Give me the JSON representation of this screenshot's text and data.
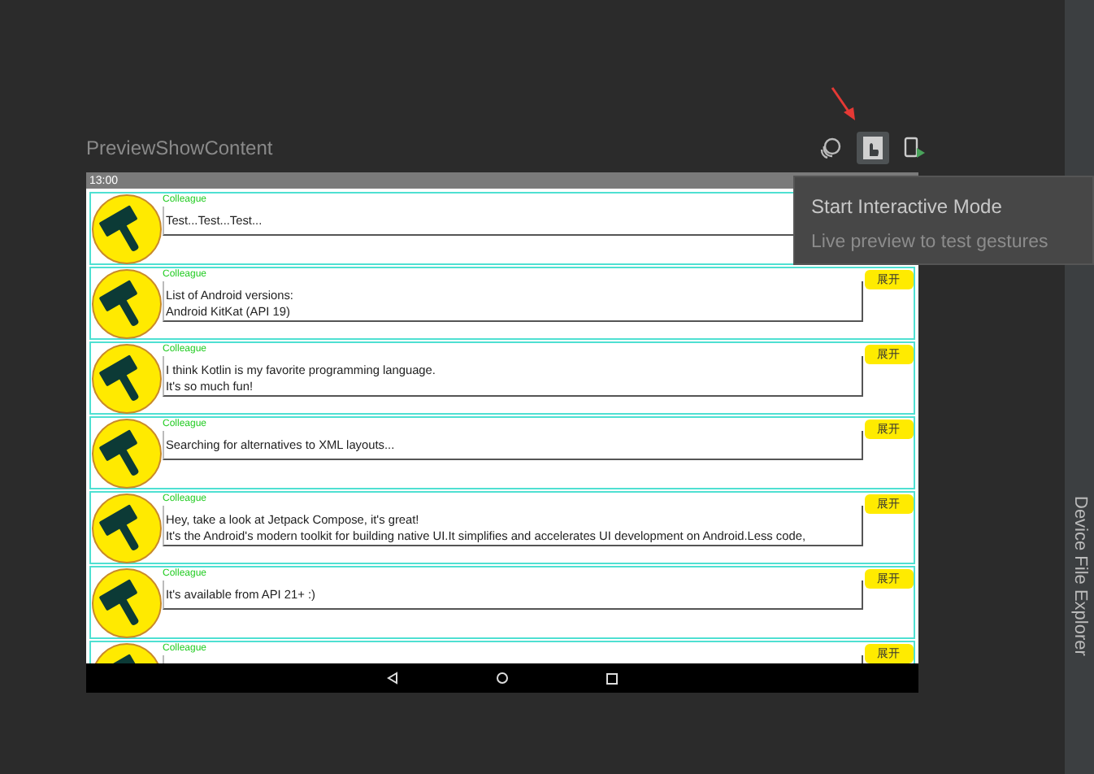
{
  "preview": {
    "title": "PreviewShowContent"
  },
  "toolbar": [
    {
      "kind": "layers",
      "selected": false
    },
    {
      "kind": "interactive",
      "selected": true
    },
    {
      "kind": "deploy",
      "selected": false
    }
  ],
  "device": {
    "status_time": "13:00",
    "messages": [
      {
        "author": "Colleague",
        "lines": [
          "Test...Test...Test..."
        ]
      },
      {
        "author": "Colleague",
        "lines": [
          "List of Android versions:",
          "Android KitKat (API 19)"
        ],
        "button": "展开"
      },
      {
        "author": "Colleague",
        "lines": [
          "I think Kotlin is my favorite programming language.",
          "It's so much fun!"
        ],
        "button": "展开"
      },
      {
        "author": "Colleague",
        "lines": [
          "Searching for alternatives to XML layouts..."
        ],
        "button": "展开"
      },
      {
        "author": "Colleague",
        "lines": [
          "Hey, take a look at Jetpack Compose, it's great!",
          "It's the Android's modern toolkit for building native UI.It simplifies and accelerates UI development on Android.Less code,"
        ],
        "button": "展开"
      },
      {
        "author": "Colleague",
        "lines": [
          "It's available from API 21+ :)"
        ],
        "button": "展开"
      },
      {
        "author": "Colleague",
        "button": "展开"
      }
    ]
  },
  "tooltip": {
    "title": "Start Interactive Mode",
    "subtitle": "Live preview to test gestures"
  },
  "side_panel": {
    "tab": "Device File Explorer"
  }
}
